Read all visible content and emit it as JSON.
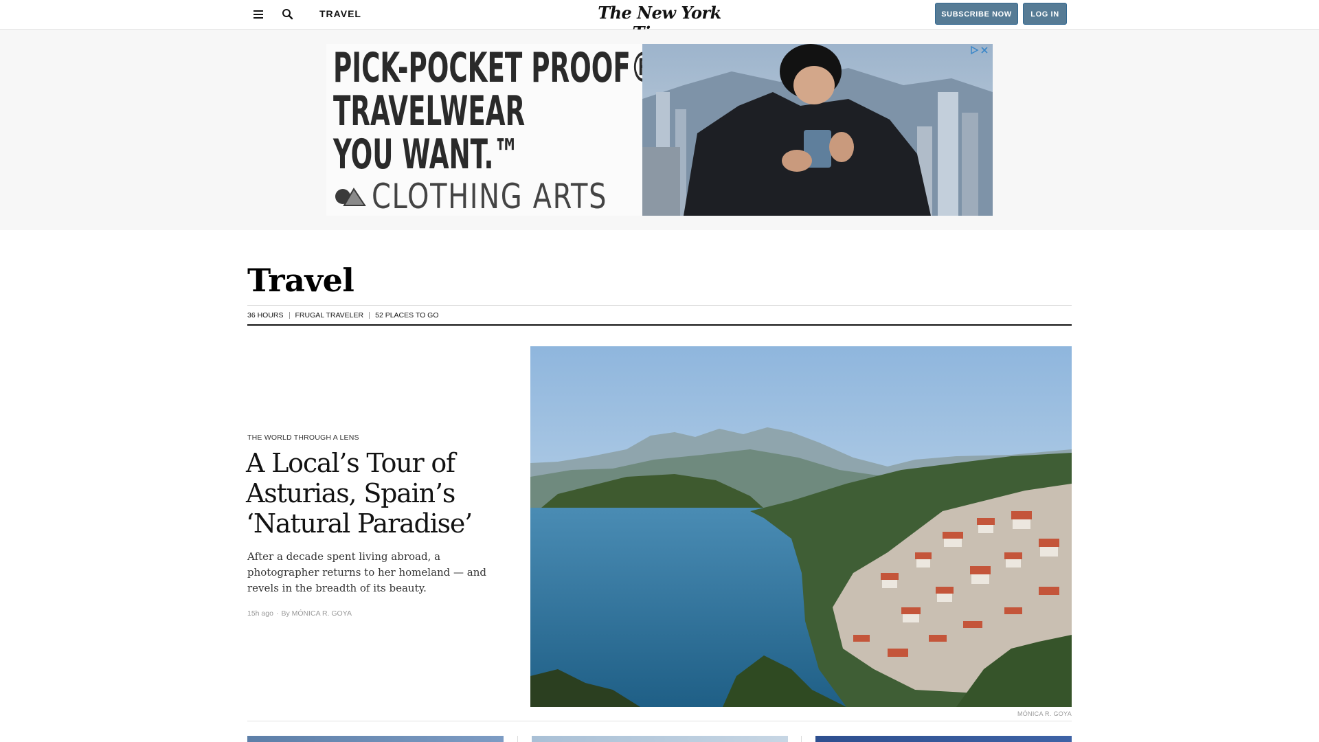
{
  "header": {
    "section": "TRAVEL",
    "logo": "The New York Times",
    "subscribe_label": "SUBSCRIBE NOW",
    "login_label": "LOG IN",
    "icons": [
      "menu-icon",
      "search-icon"
    ]
  },
  "ad": {
    "headline_lines": [
      "PICK-POCKET PROOF®",
      "TRAVELWEAR",
      "YOU WANT.™"
    ],
    "brand": "CLOTHING ARTS",
    "icons": [
      "ad-choices-icon"
    ]
  },
  "section": {
    "title": "Travel",
    "subnav": [
      "36 HOURS",
      "FRUGAL TRAVELER",
      "52 PLACES TO GO"
    ]
  },
  "lead": {
    "kicker": "THE WORLD THROUGH A LENS",
    "headline": "A Local’s Tour of Asturias, Spain’s ‘Natural Paradise’",
    "summary": "After a decade spent living abroad, a photographer returns to her homeland — and revels in the breadth of its beauty.",
    "time": "15h ago",
    "byline": "By MÓNICA R. GOYA",
    "photo_credit": "MÓNICA R. GOYA"
  },
  "colors": {
    "button_bg": "#567b95",
    "text": "#121212",
    "ad_band": "#f7f7f7"
  }
}
